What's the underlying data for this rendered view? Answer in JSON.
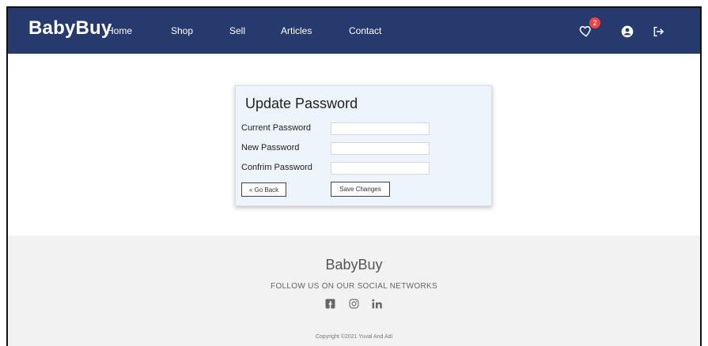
{
  "nav": {
    "brand": "BabyBuy",
    "links": [
      "Home",
      "Shop",
      "Sell",
      "Articles",
      "Contact"
    ],
    "wishlist_count": "2",
    "icons": [
      "heart-icon",
      "user-icon",
      "logout-icon"
    ]
  },
  "form": {
    "title": "Update Password",
    "fields": [
      {
        "label": "Current Password",
        "value": ""
      },
      {
        "label": "New Password",
        "value": ""
      },
      {
        "label": "Confrim Password",
        "value": ""
      }
    ],
    "back_label": "« Go Back",
    "save_label": "Save Changes"
  },
  "footer": {
    "brand": "BabyBuy",
    "follow": "FOLLOW US ON OUR SOCIAL NETWORKS",
    "social_icons": [
      "facebook-icon",
      "instagram-icon",
      "linkedin-icon"
    ],
    "copyright": "Copyright ©2021 Yuval And Adi"
  },
  "colors": {
    "navbar": "#273a6d",
    "card_bg": "#eef4fb",
    "footer_bg": "#f2f2f2",
    "badge": "#e44444"
  }
}
